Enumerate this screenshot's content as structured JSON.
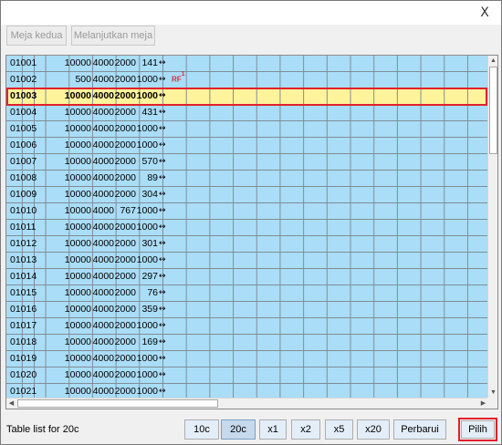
{
  "window": {
    "close_label": "X"
  },
  "toolbar": {
    "second_table": "Meja kedua",
    "continue_table": "Melanjutkan meja"
  },
  "table": {
    "rows": [
      {
        "id": "01001",
        "c1": "10000",
        "c2": "4000",
        "c3": "2000",
        "c4": "141",
        "arrow": "↔"
      },
      {
        "id": "01002",
        "c1": "500",
        "c2": "4000",
        "c3": "2000",
        "c4": "1000",
        "arrow": "↔",
        "tag": "RF",
        "tag_sup": "1"
      },
      {
        "id": "01003",
        "c1": "10000",
        "c2": "4000",
        "c3": "2000",
        "c4": "1000",
        "arrow": "↔"
      },
      {
        "id": "01004",
        "c1": "10000",
        "c2": "4000",
        "c3": "2000",
        "c4": "431",
        "arrow": "↔"
      },
      {
        "id": "01005",
        "c1": "10000",
        "c2": "4000",
        "c3": "2000",
        "c4": "1000",
        "arrow": "↔"
      },
      {
        "id": "01006",
        "c1": "10000",
        "c2": "4000",
        "c3": "2000",
        "c4": "1000",
        "arrow": "↔"
      },
      {
        "id": "01007",
        "c1": "10000",
        "c2": "4000",
        "c3": "2000",
        "c4": "570",
        "arrow": "↔"
      },
      {
        "id": "01008",
        "c1": "10000",
        "c2": "4000",
        "c3": "2000",
        "c4": "89",
        "arrow": "↔"
      },
      {
        "id": "01009",
        "c1": "10000",
        "c2": "4000",
        "c3": "2000",
        "c4": "304",
        "arrow": "↔"
      },
      {
        "id": "01010",
        "c1": "10000",
        "c2": "4000",
        "c3": "767",
        "c4": "1000",
        "arrow": "↔"
      },
      {
        "id": "01011",
        "c1": "10000",
        "c2": "4000",
        "c3": "2000",
        "c4": "1000",
        "arrow": "↔"
      },
      {
        "id": "01012",
        "c1": "10000",
        "c2": "4000",
        "c3": "2000",
        "c4": "301",
        "arrow": "↔"
      },
      {
        "id": "01013",
        "c1": "10000",
        "c2": "4000",
        "c3": "2000",
        "c4": "1000",
        "arrow": "↔"
      },
      {
        "id": "01014",
        "c1": "10000",
        "c2": "4000",
        "c3": "2000",
        "c4": "297",
        "arrow": "↔"
      },
      {
        "id": "01015",
        "c1": "10000",
        "c2": "4000",
        "c3": "2000",
        "c4": "76",
        "arrow": "↔"
      },
      {
        "id": "01016",
        "c1": "10000",
        "c2": "4000",
        "c3": "2000",
        "c4": "359",
        "arrow": "↔"
      },
      {
        "id": "01017",
        "c1": "10000",
        "c2": "4000",
        "c3": "2000",
        "c4": "1000",
        "arrow": "↔"
      },
      {
        "id": "01018",
        "c1": "10000",
        "c2": "4000",
        "c3": "2000",
        "c4": "169",
        "arrow": "↔"
      },
      {
        "id": "01019",
        "c1": "10000",
        "c2": "4000",
        "c3": "2000",
        "c4": "1000",
        "arrow": "↔"
      },
      {
        "id": "01020",
        "c1": "10000",
        "c2": "4000",
        "c3": "2000",
        "c4": "1000",
        "arrow": "↔"
      },
      {
        "id": "01021",
        "c1": "10000",
        "c2": "4000",
        "c3": "2000",
        "c4": "1000",
        "arrow": "↔"
      }
    ],
    "selected_id": "01003"
  },
  "status_text": "Table list for 20c",
  "buttons": {
    "b10c": "10c",
    "b20c": "20c",
    "x1": "x1",
    "x2": "x2",
    "x5": "x5",
    "x20": "x20",
    "refresh": "Perbarui",
    "choose": "Pilih"
  },
  "scroll_icons": {
    "up": "▲",
    "down": "▼",
    "left": "◀",
    "right": "▶"
  },
  "colors": {
    "row_bg": "#aaddf7",
    "selected_bg": "#fff39b",
    "highlight_border": "#e2202c",
    "tag": "#e0283c"
  }
}
